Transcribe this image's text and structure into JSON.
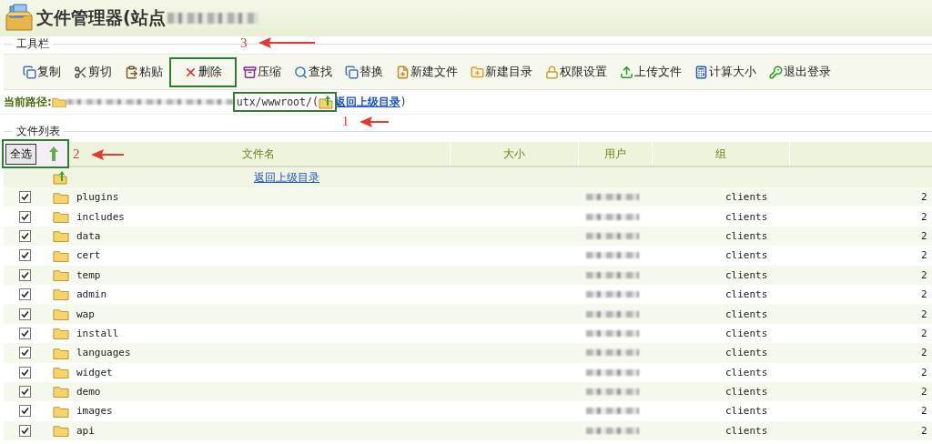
{
  "title": "文件管理器(站点",
  "toolbar": {
    "legend": "工具栏",
    "buttons": [
      {
        "label": "复制",
        "highlighted": false
      },
      {
        "label": "剪切",
        "highlighted": false
      },
      {
        "label": "粘贴",
        "highlighted": false
      },
      {
        "label": "删除",
        "highlighted": true,
        "callout": "3"
      },
      {
        "label": "压缩",
        "highlighted": false
      },
      {
        "label": "查找",
        "highlighted": false
      },
      {
        "label": "替换",
        "highlighted": false
      },
      {
        "label": "新建文件",
        "highlighted": false
      },
      {
        "label": "新建目录",
        "highlighted": false
      },
      {
        "label": "权限设置",
        "highlighted": false
      },
      {
        "label": "上传文件",
        "highlighted": false
      },
      {
        "label": "计算大小",
        "highlighted": false
      },
      {
        "label": "退出登录",
        "highlighted": false
      }
    ]
  },
  "path": {
    "label": "当前路径:",
    "visible_path": "utx/wwwroot/(",
    "up_link": "返回上级目录",
    "close": ")",
    "highlighted": true,
    "callout": "1"
  },
  "file_list": {
    "legend": "文件列表",
    "select_all": {
      "label": "全选",
      "highlighted": true,
      "callout": "2"
    },
    "columns": [
      "文件名",
      "大小",
      "用户",
      "组"
    ],
    "up_link": "返回上级目录",
    "rows": [
      {
        "name": "plugins",
        "checked": true,
        "group": "clients",
        "column_5": "2"
      },
      {
        "name": "includes",
        "checked": true,
        "group": "clients",
        "column_5": "2"
      },
      {
        "name": "data",
        "checked": true,
        "group": "clients",
        "column_5": "2"
      },
      {
        "name": "cert",
        "checked": true,
        "group": "clients",
        "column_5": "2"
      },
      {
        "name": "temp",
        "checked": true,
        "group": "clients",
        "column_5": "2"
      },
      {
        "name": "admin",
        "checked": true,
        "group": "clients",
        "column_5": "2"
      },
      {
        "name": "wap",
        "checked": true,
        "group": "clients",
        "column_5": "2"
      },
      {
        "name": "install",
        "checked": true,
        "group": "clients",
        "column_5": "2"
      },
      {
        "name": "languages",
        "checked": true,
        "group": "clients",
        "column_5": "2"
      },
      {
        "name": "widget",
        "checked": true,
        "group": "clients",
        "column_5": "2"
      },
      {
        "name": "demo",
        "checked": true,
        "group": "clients",
        "column_5": "2"
      },
      {
        "name": "images",
        "checked": true,
        "group": "clients",
        "column_5": "2"
      },
      {
        "name": "api",
        "checked": true,
        "group": "clients",
        "column_5": "2"
      }
    ]
  }
}
